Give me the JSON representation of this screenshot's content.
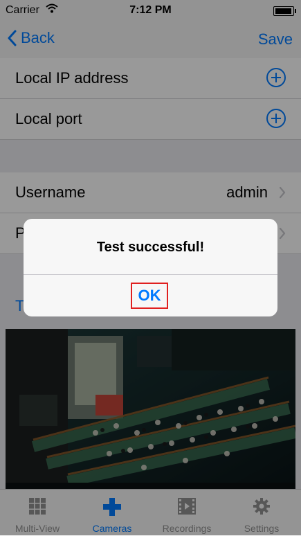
{
  "status_bar": {
    "carrier": "Carrier",
    "time": "7:12 PM"
  },
  "nav": {
    "back_label": "Back",
    "save_label": "Save"
  },
  "form": {
    "local_ip_label": "Local IP address",
    "local_port_label": "Local port",
    "username_label": "Username",
    "username_value": "admin",
    "password_label": "P",
    "test_link_label": "T"
  },
  "preview": {
    "icon": "camera-preview-image"
  },
  "tabs": [
    {
      "label": "Multi-View",
      "icon": "grid-icon"
    },
    {
      "label": "Cameras",
      "icon": "plus-icon",
      "active": true
    },
    {
      "label": "Recordings",
      "icon": "film-icon"
    },
    {
      "label": "Settings",
      "icon": "gear-icon"
    }
  ],
  "alert": {
    "title": "Test successful!",
    "ok_label": "OK"
  },
  "colors": {
    "accent": "#007aff",
    "highlight_border": "#e02020"
  }
}
